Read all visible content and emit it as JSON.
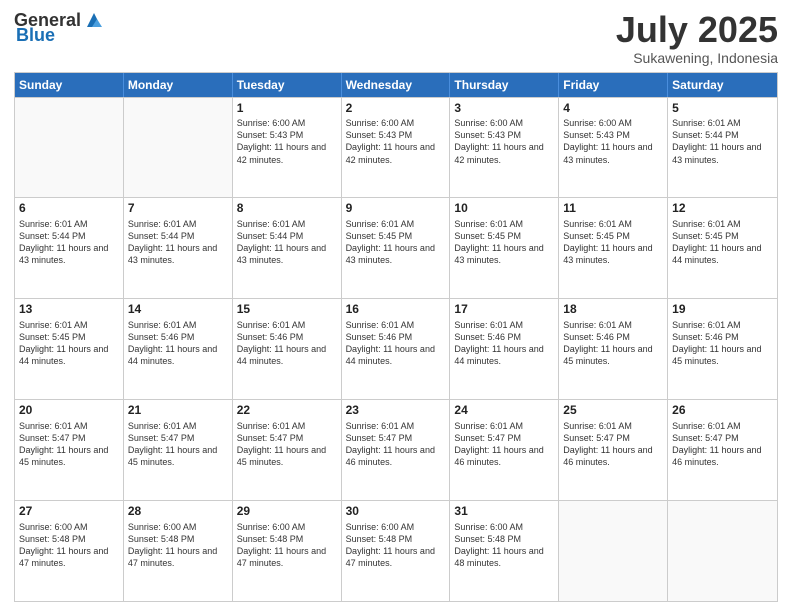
{
  "header": {
    "logo_general": "General",
    "logo_blue": "Blue",
    "month": "July 2025",
    "location": "Sukawening, Indonesia"
  },
  "days_of_week": [
    "Sunday",
    "Monday",
    "Tuesday",
    "Wednesday",
    "Thursday",
    "Friday",
    "Saturday"
  ],
  "weeks": [
    [
      {
        "day": "",
        "empty": true
      },
      {
        "day": "",
        "empty": true
      },
      {
        "day": "1",
        "sunrise": "Sunrise: 6:00 AM",
        "sunset": "Sunset: 5:43 PM",
        "daylight": "Daylight: 11 hours and 42 minutes."
      },
      {
        "day": "2",
        "sunrise": "Sunrise: 6:00 AM",
        "sunset": "Sunset: 5:43 PM",
        "daylight": "Daylight: 11 hours and 42 minutes."
      },
      {
        "day": "3",
        "sunrise": "Sunrise: 6:00 AM",
        "sunset": "Sunset: 5:43 PM",
        "daylight": "Daylight: 11 hours and 42 minutes."
      },
      {
        "day": "4",
        "sunrise": "Sunrise: 6:00 AM",
        "sunset": "Sunset: 5:43 PM",
        "daylight": "Daylight: 11 hours and 43 minutes."
      },
      {
        "day": "5",
        "sunrise": "Sunrise: 6:01 AM",
        "sunset": "Sunset: 5:44 PM",
        "daylight": "Daylight: 11 hours and 43 minutes."
      }
    ],
    [
      {
        "day": "6",
        "sunrise": "Sunrise: 6:01 AM",
        "sunset": "Sunset: 5:44 PM",
        "daylight": "Daylight: 11 hours and 43 minutes."
      },
      {
        "day": "7",
        "sunrise": "Sunrise: 6:01 AM",
        "sunset": "Sunset: 5:44 PM",
        "daylight": "Daylight: 11 hours and 43 minutes."
      },
      {
        "day": "8",
        "sunrise": "Sunrise: 6:01 AM",
        "sunset": "Sunset: 5:44 PM",
        "daylight": "Daylight: 11 hours and 43 minutes."
      },
      {
        "day": "9",
        "sunrise": "Sunrise: 6:01 AM",
        "sunset": "Sunset: 5:45 PM",
        "daylight": "Daylight: 11 hours and 43 minutes."
      },
      {
        "day": "10",
        "sunrise": "Sunrise: 6:01 AM",
        "sunset": "Sunset: 5:45 PM",
        "daylight": "Daylight: 11 hours and 43 minutes."
      },
      {
        "day": "11",
        "sunrise": "Sunrise: 6:01 AM",
        "sunset": "Sunset: 5:45 PM",
        "daylight": "Daylight: 11 hours and 43 minutes."
      },
      {
        "day": "12",
        "sunrise": "Sunrise: 6:01 AM",
        "sunset": "Sunset: 5:45 PM",
        "daylight": "Daylight: 11 hours and 44 minutes."
      }
    ],
    [
      {
        "day": "13",
        "sunrise": "Sunrise: 6:01 AM",
        "sunset": "Sunset: 5:45 PM",
        "daylight": "Daylight: 11 hours and 44 minutes."
      },
      {
        "day": "14",
        "sunrise": "Sunrise: 6:01 AM",
        "sunset": "Sunset: 5:46 PM",
        "daylight": "Daylight: 11 hours and 44 minutes."
      },
      {
        "day": "15",
        "sunrise": "Sunrise: 6:01 AM",
        "sunset": "Sunset: 5:46 PM",
        "daylight": "Daylight: 11 hours and 44 minutes."
      },
      {
        "day": "16",
        "sunrise": "Sunrise: 6:01 AM",
        "sunset": "Sunset: 5:46 PM",
        "daylight": "Daylight: 11 hours and 44 minutes."
      },
      {
        "day": "17",
        "sunrise": "Sunrise: 6:01 AM",
        "sunset": "Sunset: 5:46 PM",
        "daylight": "Daylight: 11 hours and 44 minutes."
      },
      {
        "day": "18",
        "sunrise": "Sunrise: 6:01 AM",
        "sunset": "Sunset: 5:46 PM",
        "daylight": "Daylight: 11 hours and 45 minutes."
      },
      {
        "day": "19",
        "sunrise": "Sunrise: 6:01 AM",
        "sunset": "Sunset: 5:46 PM",
        "daylight": "Daylight: 11 hours and 45 minutes."
      }
    ],
    [
      {
        "day": "20",
        "sunrise": "Sunrise: 6:01 AM",
        "sunset": "Sunset: 5:47 PM",
        "daylight": "Daylight: 11 hours and 45 minutes."
      },
      {
        "day": "21",
        "sunrise": "Sunrise: 6:01 AM",
        "sunset": "Sunset: 5:47 PM",
        "daylight": "Daylight: 11 hours and 45 minutes."
      },
      {
        "day": "22",
        "sunrise": "Sunrise: 6:01 AM",
        "sunset": "Sunset: 5:47 PM",
        "daylight": "Daylight: 11 hours and 45 minutes."
      },
      {
        "day": "23",
        "sunrise": "Sunrise: 6:01 AM",
        "sunset": "Sunset: 5:47 PM",
        "daylight": "Daylight: 11 hours and 46 minutes."
      },
      {
        "day": "24",
        "sunrise": "Sunrise: 6:01 AM",
        "sunset": "Sunset: 5:47 PM",
        "daylight": "Daylight: 11 hours and 46 minutes."
      },
      {
        "day": "25",
        "sunrise": "Sunrise: 6:01 AM",
        "sunset": "Sunset: 5:47 PM",
        "daylight": "Daylight: 11 hours and 46 minutes."
      },
      {
        "day": "26",
        "sunrise": "Sunrise: 6:01 AM",
        "sunset": "Sunset: 5:47 PM",
        "daylight": "Daylight: 11 hours and 46 minutes."
      }
    ],
    [
      {
        "day": "27",
        "sunrise": "Sunrise: 6:00 AM",
        "sunset": "Sunset: 5:48 PM",
        "daylight": "Daylight: 11 hours and 47 minutes."
      },
      {
        "day": "28",
        "sunrise": "Sunrise: 6:00 AM",
        "sunset": "Sunset: 5:48 PM",
        "daylight": "Daylight: 11 hours and 47 minutes."
      },
      {
        "day": "29",
        "sunrise": "Sunrise: 6:00 AM",
        "sunset": "Sunset: 5:48 PM",
        "daylight": "Daylight: 11 hours and 47 minutes."
      },
      {
        "day": "30",
        "sunrise": "Sunrise: 6:00 AM",
        "sunset": "Sunset: 5:48 PM",
        "daylight": "Daylight: 11 hours and 47 minutes."
      },
      {
        "day": "31",
        "sunrise": "Sunrise: 6:00 AM",
        "sunset": "Sunset: 5:48 PM",
        "daylight": "Daylight: 11 hours and 48 minutes."
      },
      {
        "day": "",
        "empty": true
      },
      {
        "day": "",
        "empty": true
      }
    ]
  ]
}
